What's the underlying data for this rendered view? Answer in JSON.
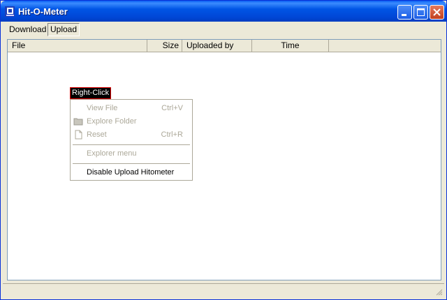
{
  "window": {
    "title": "Hit-O-Meter"
  },
  "icons": {
    "app": "app-icon",
    "minimize": "minimize-icon",
    "maximize": "maximize-icon",
    "close": "close-icon",
    "folder": "folder-icon",
    "document": "document-icon",
    "grip": "size-grip-icon"
  },
  "tabs": [
    {
      "label": "Download",
      "active": false
    },
    {
      "label": "Upload",
      "active": true
    }
  ],
  "list": {
    "columns": [
      "File",
      "Size",
      "Uploaded by",
      "Time"
    ],
    "rows": []
  },
  "hint": {
    "label": "Right-Click"
  },
  "context_menu": {
    "items": [
      {
        "label": "View File",
        "shortcut": "Ctrl+V",
        "enabled": false
      },
      {
        "label": "Explore Folder",
        "shortcut": "",
        "enabled": false
      },
      {
        "label": "Reset",
        "shortcut": "Ctrl+R",
        "enabled": false
      },
      {
        "label": "Explorer menu",
        "shortcut": "",
        "enabled": false
      },
      {
        "label": "Disable Upload Hitometer",
        "shortcut": "",
        "enabled": true
      }
    ]
  },
  "status": {
    "text": ""
  },
  "colors": {
    "titlebar": "#0055e5",
    "face": "#ece9d8",
    "disabled_text": "#aca899",
    "hint_border": "#e00000"
  }
}
